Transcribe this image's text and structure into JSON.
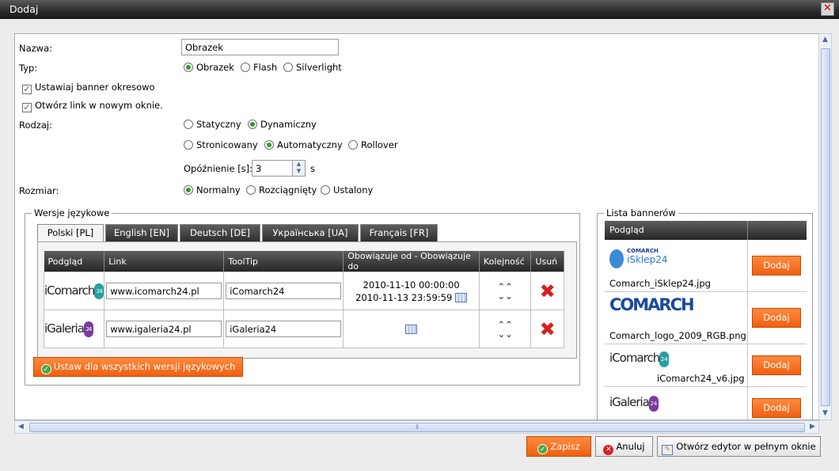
{
  "window": {
    "title": "Dodaj"
  },
  "form": {
    "nazwa_label": "Nazwa:",
    "nazwa_value": "Obrazek",
    "typ_label": "Typ:",
    "typ_options": [
      "Obrazek",
      "Flash",
      "Silverlight"
    ],
    "typ_selected": "Obrazek",
    "checkbox_okresowo": "Ustawiaj banner okresowo",
    "checkbox_nowe_okno": "Otwórz link w nowym oknie.",
    "rodzaj_label": "Rodzaj:",
    "rodzaj_options_1": [
      "Statyczny",
      "Dynamiczny"
    ],
    "rodzaj_selected_1": "Dynamiczny",
    "rodzaj_options_2": [
      "Stronicowany",
      "Automatyczny",
      "Rollover"
    ],
    "rodzaj_selected_2": "Automatyczny",
    "opoznienie_label": "Opóźnienie [s]:",
    "opoznienie_value": "3",
    "opoznienie_unit": "s",
    "rozmiar_label": "Rozmiar:",
    "rozmiar_options": [
      "Normalny",
      "Rozciągnięty",
      "Ustalony"
    ],
    "rozmiar_selected": "Normalny"
  },
  "wersje": {
    "legend": "Wersje językowe",
    "tabs": [
      "Polski [PL]",
      "English [EN]",
      "Deutsch [DE]",
      "Українська [UA]",
      "Français [FR]"
    ],
    "active_tab": "Polski [PL]",
    "columns": [
      "Podgląd",
      "Link",
      "ToolTip",
      "Obowiązuje od - Obowiązuje do",
      "Kolejność",
      "Usuń"
    ],
    "rows": [
      {
        "preview": "iComarch",
        "link": "www.icomarch24.pl",
        "tooltip": "iComarch24",
        "date_from": "2010-11-10 00:00:00",
        "date_to": "2010-11-13 23:59:59"
      },
      {
        "preview": "iGaleria",
        "link": "www.igaleria24.pl",
        "tooltip": "iGaleria24",
        "date_from": "",
        "date_to": ""
      }
    ],
    "badge_text": "24",
    "apply_all_button": "Ustaw dla wszystkich wersji językowych"
  },
  "lista": {
    "legend": "Lista bannerów",
    "column": "Podgląd",
    "add_label": "Dodaj",
    "items": [
      {
        "logo_line1": "COMARCH",
        "logo_line2": "iSklep24",
        "filename": "Comarch_iSklep24.jpg"
      },
      {
        "logo_text": "COMARCH",
        "filename": "Comarch_logo_2009_RGB.png"
      },
      {
        "logo_text": "iComarch",
        "filename": "iComarch24_v6.jpg"
      },
      {
        "logo_text": "iGaleria",
        "filename": ""
      }
    ]
  },
  "footer": {
    "save": "Zapisz",
    "cancel": "Anuluj",
    "full_editor": "Otwórz edytor w pełnym oknie"
  },
  "icons": {
    "close": "close-icon",
    "check_ok": "checkmark-circle-icon",
    "cancel": "x-circle-icon",
    "calendar": "calendar-icon",
    "delete": "delete-x-icon",
    "move": "double-chevron-icon",
    "editor": "edit-window-icon"
  },
  "colors": {
    "accent_orange": "#f06010",
    "header_dark": "#2a2a2a",
    "radio_on": "#2e9c2e",
    "delete_red": "#d42020"
  }
}
